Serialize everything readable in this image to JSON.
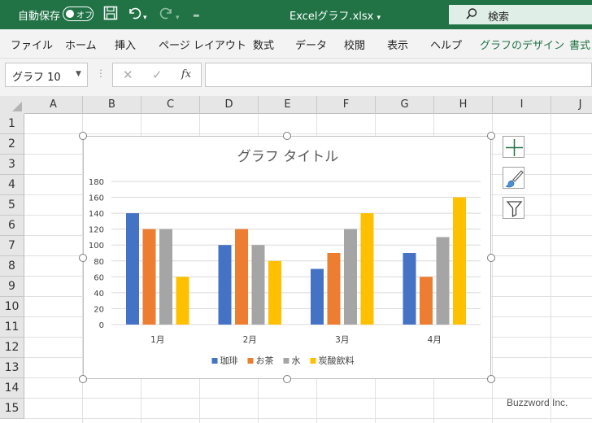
{
  "titlebar": {
    "autosave_label": "自動保存",
    "autosave_state": "オフ",
    "filename": "Excelグラフ.xlsx",
    "search_placeholder": "検索"
  },
  "ribbon": {
    "tabs": [
      "ファイル",
      "ホーム",
      "挿入",
      "ページ レイアウト",
      "数式",
      "データ",
      "校閲",
      "表示",
      "ヘルプ",
      "グラフのデザイン",
      "書式"
    ]
  },
  "formula_bar": {
    "name_box": "グラフ 10",
    "cancel": "✕",
    "enter": "✓",
    "fx": "fx",
    "content": ""
  },
  "sheet": {
    "columns": [
      "A",
      "B",
      "C",
      "D",
      "E",
      "F",
      "G",
      "H",
      "I",
      "J"
    ],
    "rows": [
      "1",
      "2",
      "3",
      "4",
      "5",
      "6",
      "7",
      "8",
      "9",
      "10",
      "11",
      "12",
      "13",
      "14",
      "15"
    ]
  },
  "watermark": "Buzzword Inc.",
  "colors": {
    "accent": "#217346",
    "series": [
      "#4472C4",
      "#ED7D31",
      "#A5A5A5",
      "#FFC000"
    ]
  },
  "chart_data": {
    "type": "bar",
    "title": "グラフ タイトル",
    "categories": [
      "1月",
      "2月",
      "3月",
      "4月"
    ],
    "series": [
      {
        "name": "珈琲",
        "values": [
          140,
          100,
          70,
          90
        ]
      },
      {
        "name": "お茶",
        "values": [
          120,
          120,
          90,
          60
        ]
      },
      {
        "name": "水",
        "values": [
          120,
          100,
          120,
          110
        ]
      },
      {
        "name": "炭酸飲料",
        "values": [
          60,
          80,
          140,
          160
        ]
      }
    ],
    "ylim": [
      0,
      180
    ],
    "yticks": [
      0,
      20,
      40,
      60,
      80,
      100,
      120,
      140,
      160,
      180
    ],
    "grid": true,
    "legend": "bottom",
    "xlabel": "",
    "ylabel": ""
  }
}
